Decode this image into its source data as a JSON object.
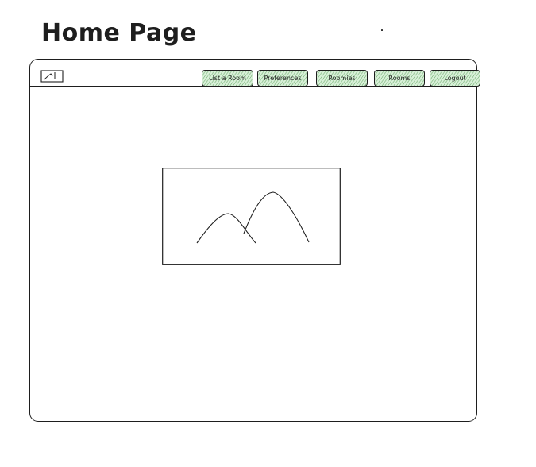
{
  "title": "Home Page",
  "nav": {
    "items": [
      {
        "label": "List a Room"
      },
      {
        "label": "Preferences"
      },
      {
        "label": "Roomies"
      },
      {
        "label": "Rooms"
      },
      {
        "label": "Logout"
      }
    ]
  },
  "colors": {
    "stroke": "#1e1e1e",
    "button_fill": "#d8f0d8",
    "button_hatch": "#3c8c3c",
    "background": "#ffffff"
  },
  "icons": {
    "logo": "image-icon",
    "hero": "image-placeholder-icon"
  }
}
